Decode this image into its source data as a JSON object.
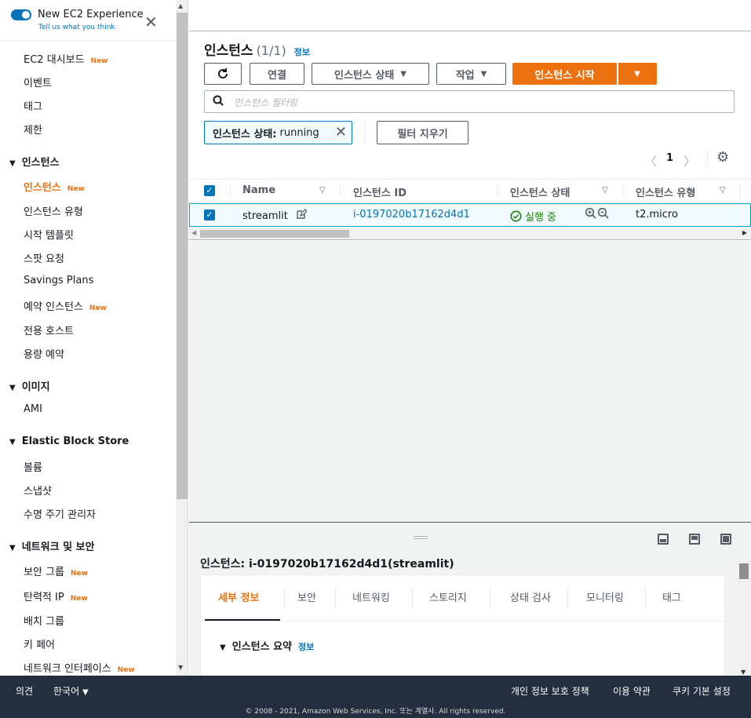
{
  "sidebar": {
    "toggle_title": "New EC2 Experience",
    "toggle_sub": "Tell us what you think",
    "new_badge": "New",
    "items": [
      {
        "label": "EC2 대시보드"
      },
      {
        "label": "이벤트"
      },
      {
        "label": "태그"
      },
      {
        "label": "제한"
      }
    ],
    "sections": [
      {
        "label": "인스턴스",
        "items": [
          "인스턴스",
          "인스턴스 유형",
          "시작 템플릿",
          "스팟 요청",
          "Savings Plans",
          "예약 인스턴스",
          "전용 호스트",
          "용량 예약"
        ]
      },
      {
        "label": "이미지",
        "items": [
          "AMI"
        ]
      },
      {
        "label": "Elastic Block Store",
        "items": [
          "볼륨",
          "스냅샷",
          "수명 주기 관리자"
        ]
      },
      {
        "label": "네트워크 및 보안",
        "items": [
          "보안 그룹",
          "탄력적 IP",
          "배치 그룹",
          "키 페어",
          "네트워크 인터페이스"
        ]
      }
    ]
  },
  "panel": {
    "title": "인스턴스",
    "count": "(1/1)",
    "info": "정보",
    "buttons": {
      "connect": "연결",
      "instance_state": "인스턴스 상태",
      "actions": "작업",
      "launch": "인스턴스 시작"
    },
    "search_placeholder": "인스턴스 필터링",
    "filter_token_key": "인스턴스 상태:",
    "filter_token_value": "running",
    "clear_filters": "필터 지우기",
    "page": "1"
  },
  "table": {
    "columns": [
      "Name",
      "인스턴스 ID",
      "인스턴스 상태",
      "인스턴스 유형"
    ],
    "rows": [
      {
        "name": "streamlit",
        "id": "i-0197020b17162d4d1",
        "state": "실행 중",
        "type": "t2.micro"
      }
    ]
  },
  "details": {
    "title_prefix": "인스턴스:",
    "title_value": "i-0197020b17162d4d1(streamlit)",
    "tabs": [
      "세부 정보",
      "보안",
      "네트워킹",
      "스토리지",
      "상태 검사",
      "모니터링",
      "태그"
    ],
    "section": "인스턴스 요약",
    "section_info": "정보"
  },
  "footer": {
    "feedback": "의견",
    "language": "한국어",
    "privacy": "개인 정보 보호 정책",
    "terms": "이용 약관",
    "cookies": "쿠키 기본 설정",
    "copyright": "© 2008 - 2021, Amazon Web Services, Inc. 또는 계열사. All rights reserved."
  },
  "colors": {
    "accent": "#ec7211",
    "link": "#0073bb",
    "footer_bg": "#232f3e",
    "running": "#1d8102"
  }
}
